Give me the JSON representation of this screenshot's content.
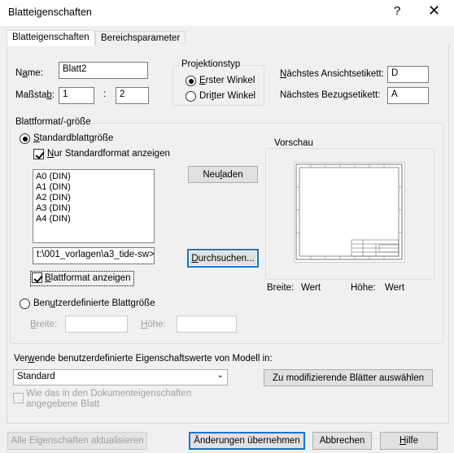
{
  "window": {
    "title": "Blatteigenschaften",
    "help_glyph": "?",
    "close_glyph": "✕"
  },
  "tabs": [
    {
      "label": "Blatteigenschaften",
      "active": true
    },
    {
      "label": "Bereichsparameter",
      "active": false
    }
  ],
  "name": {
    "label_pre": "N",
    "label_u": "a",
    "label_post": "me:",
    "value": "Blatt2"
  },
  "scale": {
    "label_pre": "Maßsta",
    "label_u": "b",
    "label_post": ":",
    "num": "1",
    "sep": ":",
    "den": "2"
  },
  "projection": {
    "title": "Projektionstyp",
    "first": {
      "pre": "",
      "u": "E",
      "post": "rster Winkel",
      "checked": true
    },
    "third": {
      "pre": "Dri",
      "u": "t",
      "post": "ter Winkel",
      "checked": false
    }
  },
  "next_view": {
    "pre": "",
    "u": "N",
    "post": "ächstes Ansichtsetikett:",
    "value": "D"
  },
  "next_ref": {
    "pre": "Nächstes Bezu",
    "u": "g",
    "post": "setikett:",
    "value": "A"
  },
  "format_group": {
    "title": "Blattformat/-größe"
  },
  "standard": {
    "pre": "",
    "u": "S",
    "post": "tandardblattgröße",
    "checked": true
  },
  "only_standard": {
    "pre": "",
    "u": "N",
    "post": "ur Standardformat anzeigen",
    "checked": true
  },
  "sizes": [
    "A0 (DIN)",
    "A1 (DIN)",
    "A2 (DIN)",
    "A3 (DIN)",
    "A4 (DIN)"
  ],
  "reload_button": {
    "pre": "Neu ",
    "u": "l",
    "post": "aden"
  },
  "path": "t:\\001_vorlagen\\a3_tide-sw>",
  "browse_button": {
    "pre": "",
    "u": "D",
    "post": "urchsuchen..."
  },
  "show_format": {
    "pre": "",
    "u": "B",
    "post": "lattformat anzeigen",
    "checked": true
  },
  "preview": {
    "title": "Vorschau",
    "width_label": "Breite:",
    "width_value": "Wert",
    "height_label": "Höhe:",
    "height_value": "Wert"
  },
  "custom": {
    "pre": "Ben",
    "u": "u",
    "post": "tzerdefinierte Blattgröße",
    "checked": false
  },
  "custom_width": {
    "pre": "",
    "u": "B",
    "post": "reite:"
  },
  "custom_height": {
    "pre": "",
    "u": "H",
    "post": "öhe:"
  },
  "props": {
    "label_pre": "Ver",
    "label_u": "w",
    "label_post": "ende benutzerdefinierte Eigenschaftswerte von Modell in:",
    "selected": "Standard",
    "modify_button": "Zu modifizierende Blätter auswählen",
    "same_as_doc": "Wie das in den Dokumenteigenschaften angegebene Blatt",
    "same_as_doc_line1": "Wie das in den Dokumenteigenschaften",
    "same_as_doc_line2": "angegebene Blatt"
  },
  "footer": {
    "update_all": "Alle Eigenschaften aktualisieren",
    "apply": "Änderungen übernehmen",
    "cancel": "Abbrechen",
    "help_pre": "",
    "help_u": "H",
    "help_post": "ilfe"
  }
}
